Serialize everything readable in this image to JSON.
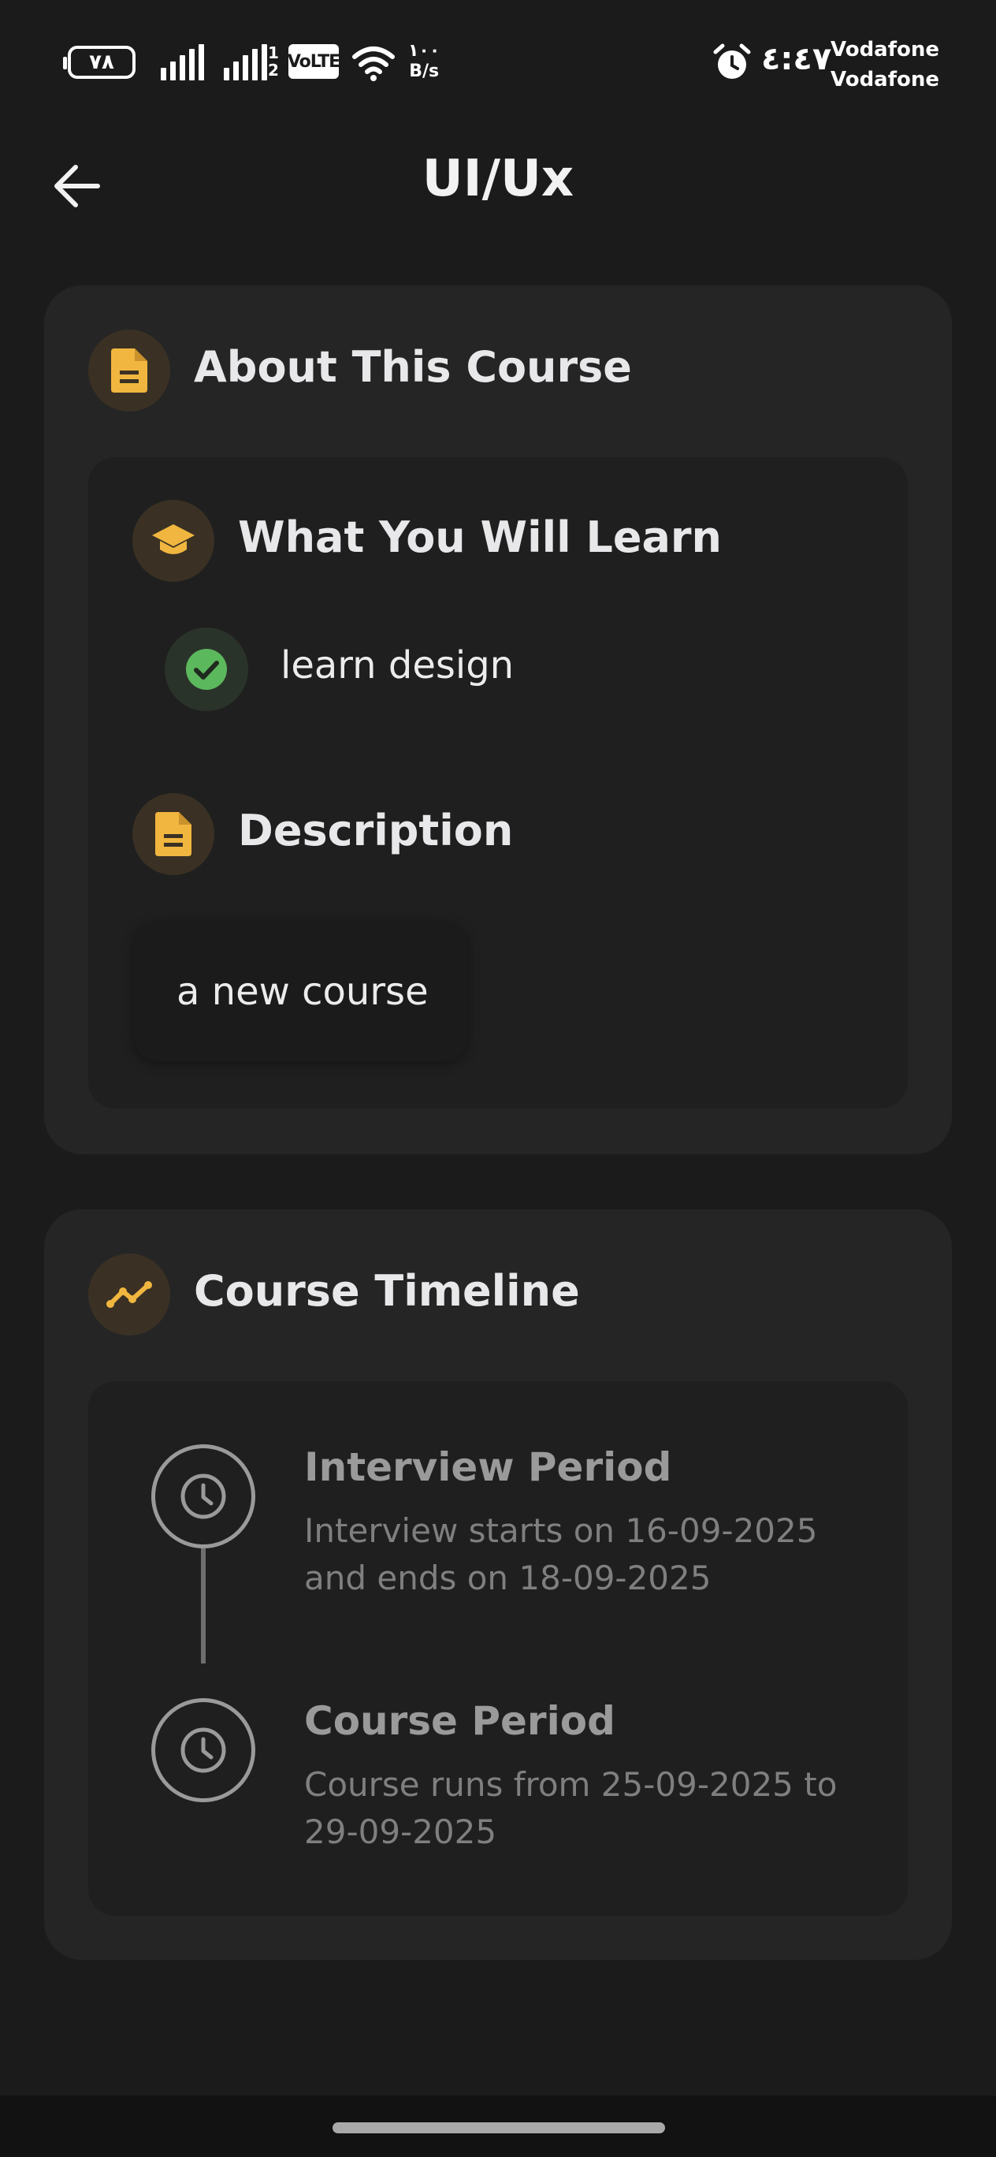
{
  "status_bar": {
    "battery_level": "٧٨",
    "sim2_label": "1\n2",
    "volte": "VoLTE",
    "speed_value": "١٠٠",
    "speed_unit": "B/s",
    "time": "٤:٤٧",
    "carrier1": "Vodafone",
    "carrier2": "Vodafone"
  },
  "app_bar": {
    "title": "UI/Ux",
    "back_icon": "arrow-left-icon"
  },
  "about": {
    "heading": "About This Course",
    "learn_heading": "What You Will Learn",
    "learn_items": [
      "learn design"
    ],
    "description_heading": "Description",
    "description_text": "a new course"
  },
  "timeline": {
    "heading": "Course Timeline",
    "items": [
      {
        "title": "Interview Period",
        "desc": "Interview starts on 16-09-2025 and ends on 18-09-2025"
      },
      {
        "title": "Course Period",
        "desc": "Course runs from 25-09-2025 to 29-09-2025"
      }
    ]
  },
  "colors": {
    "accent": "#f0b63f",
    "check_green": "#5cb85c",
    "background": "#1b1b1b",
    "card": "#252525"
  }
}
